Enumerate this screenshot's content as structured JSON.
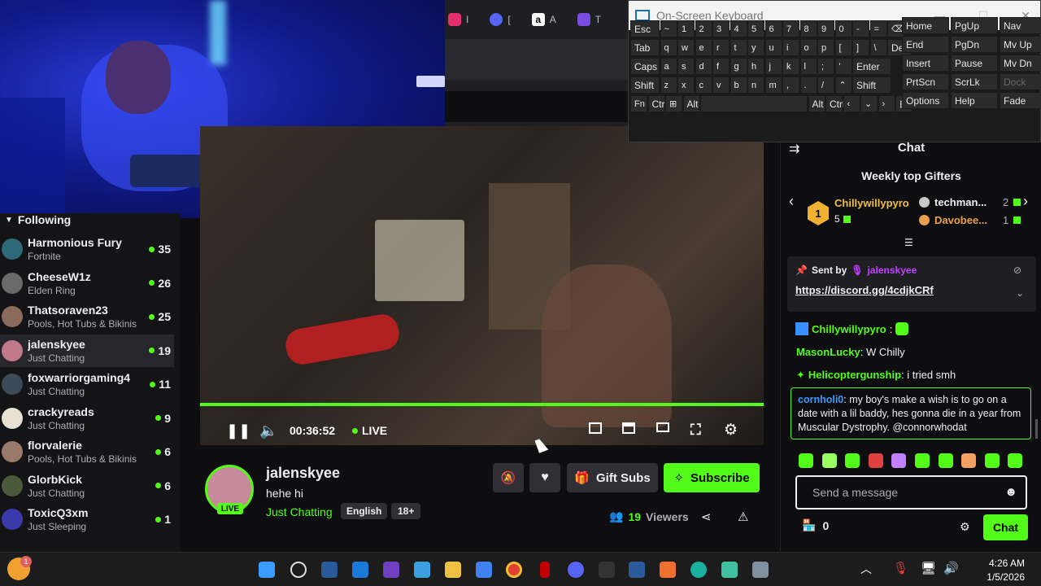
{
  "sidebar": {
    "heading": "Following",
    "channels": [
      {
        "name": "Harmonious Fury",
        "category": "Fortnite",
        "viewers": "35",
        "color": "#2c6a7a"
      },
      {
        "name": "CheeseW1z",
        "category": "Elden Ring",
        "viewers": "26",
        "color": "#6a6a6a"
      },
      {
        "name": "Thatsoraven23",
        "category": "Pools, Hot Tubs & Bikinis",
        "viewers": "25",
        "color": "#8a6a5a"
      },
      {
        "name": "jalenskyee",
        "category": "Just Chatting",
        "viewers": "19",
        "color": "#c07a8a"
      },
      {
        "name": "foxwarriorgaming4",
        "category": "Just Chatting",
        "viewers": "11",
        "color": "#3a4a5a"
      },
      {
        "name": "crackyreads",
        "category": "Just Chatting",
        "viewers": "9",
        "color": "#e8e0d0"
      },
      {
        "name": "florvalerie",
        "category": "Pools, Hot Tubs & Bikinis",
        "viewers": "6",
        "color": "#9a7a6a"
      },
      {
        "name": "GlorbKick",
        "category": "Just Chatting",
        "viewers": "6",
        "color": "#4a5a3a"
      },
      {
        "name": "ToxicQ3xm",
        "category": "Just Sleeping",
        "viewers": "1",
        "color": "#3a3aaa"
      }
    ]
  },
  "browser_tabs": [
    {
      "label": "I",
      "icon": "instagram-icon",
      "color": "#e1306c"
    },
    {
      "label": "[",
      "icon": "discord-icon",
      "color": "#5865f2"
    },
    {
      "label": "A",
      "icon": "amazon-icon",
      "color": "#ffffff"
    },
    {
      "label": "T",
      "icon": "app-w-icon",
      "color": "#7b4de0"
    }
  ],
  "osk": {
    "title": "On-Screen Keyboard",
    "rows": [
      [
        "Esc",
        "~",
        "1",
        "2",
        "3",
        "4",
        "5",
        "6",
        "7",
        "8",
        "9",
        "0",
        "-",
        "=",
        "⌫"
      ],
      [
        "Tab",
        "q",
        "w",
        "e",
        "r",
        "t",
        "y",
        "u",
        "i",
        "o",
        "p",
        "[",
        "]",
        "\\",
        "Del"
      ],
      [
        "Caps",
        "a",
        "s",
        "d",
        "f",
        "g",
        "h",
        "j",
        "k",
        "l",
        ";",
        "'",
        "Enter"
      ],
      [
        "Shift",
        "z",
        "x",
        "c",
        "v",
        "b",
        "n",
        "m",
        ",",
        ".",
        "/",
        "⌃",
        "Shift"
      ],
      [
        "Fn",
        "Ctrl",
        "⊞",
        "Alt",
        "",
        "Alt",
        "Ctrl",
        "‹",
        "⌄",
        "›",
        "▤"
      ]
    ],
    "side_keys": [
      [
        "Home",
        "PgUp",
        "Nav"
      ],
      [
        "End",
        "PgDn",
        "Mv Up"
      ],
      [
        "Insert",
        "Pause",
        "Mv Dn"
      ],
      [
        "PrtScn",
        "ScrLk",
        "Dock"
      ],
      [
        "Options",
        "Help",
        "Fade"
      ]
    ]
  },
  "player": {
    "time": "00:36:52",
    "live_label": "LIVE",
    "progress": 1.0
  },
  "streamer": {
    "name": "jalenskyee",
    "title": "hehe hi",
    "category": "Just Chatting",
    "tags": [
      "English",
      "18+"
    ],
    "live_badge": "LIVE",
    "viewers_count": "19",
    "viewers_label": "Viewers",
    "gift_label": "Gift Subs",
    "subscribe_label": "Subscribe"
  },
  "chat": {
    "header": "Chat",
    "gifters_title": "Weekly top Gifters",
    "gifters": [
      {
        "rank": "1",
        "name": "Chillywillypyro",
        "count": "5",
        "color": "#f0c040"
      },
      {
        "rank": "2",
        "name": "techman...",
        "count": "2",
        "color": "#efeff1"
      },
      {
        "rank": "3",
        "name": "Davobee...",
        "count": "1",
        "color": "#e8a050"
      }
    ],
    "pinned": {
      "sent_by_label": "Sent by",
      "sender": "jalenskyee",
      "link": "https://discord.gg/4cdjkCRf"
    },
    "messages": [
      {
        "user": "Chillywillypyro",
        "color": "#53fc18",
        "text": ""
      },
      {
        "user": "MasonLucky",
        "color": "#53fc18",
        "text": "W Chilly"
      },
      {
        "user": "Helicoptergunship",
        "color": "#53fc18",
        "text": "i tried smh"
      },
      {
        "user": "cornholi0",
        "color": "#3a9cff",
        "text": "my boy's make a wish is to go on a date with a lil baddy, hes gonna die in a year from Muscular Dystrophy. @connorwhodat"
      }
    ],
    "input_placeholder": "Send a message",
    "points": "0",
    "send_label": "Chat"
  },
  "taskbar": {
    "time": "4:26 AM",
    "date": "1/5/2026",
    "notification_count": "1"
  },
  "colors": {
    "accent": "#53fc18",
    "bg": "#0e0e10"
  }
}
